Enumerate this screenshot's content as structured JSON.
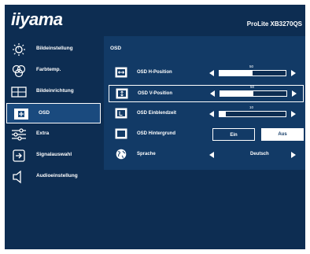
{
  "brand": {
    "logo_text": "iiyama",
    "model": "ProLite XB3270QS"
  },
  "menu": {
    "items": [
      {
        "label": "Bildeinstellung",
        "icon": "brightness-icon"
      },
      {
        "label": "Farbtemp.",
        "icon": "color-palette-icon"
      },
      {
        "label": "Bildeinrichtung",
        "icon": "screen-layout-icon"
      },
      {
        "label": "OSD",
        "icon": "osd-menu-icon",
        "active": true
      },
      {
        "label": "Extra",
        "icon": "sliders-icon"
      },
      {
        "label": "Signalauswahl",
        "icon": "input-signal-icon"
      },
      {
        "label": "Audioeinstellung",
        "icon": "speaker-icon"
      }
    ]
  },
  "panel": {
    "title": "OSD",
    "rows": [
      {
        "label": "OSD H-Position",
        "value": 50,
        "icon": "h-position-icon"
      },
      {
        "label": "OSD V-Position",
        "value": 50,
        "icon": "v-position-icon",
        "focused": true
      },
      {
        "label": "OSD Einblendzeit",
        "value": 10,
        "icon": "timer-icon"
      },
      {
        "label": "OSD Hintergrund",
        "icon": "background-icon",
        "options": [
          "Ein",
          "Aus"
        ],
        "selected": "Aus"
      },
      {
        "label": "Sprache",
        "icon": "globe-icon",
        "value_text": "Deutsch"
      }
    ]
  },
  "colors": {
    "background": "#0d2d52",
    "panel": "#123a66",
    "highlight": "#ffffff"
  }
}
